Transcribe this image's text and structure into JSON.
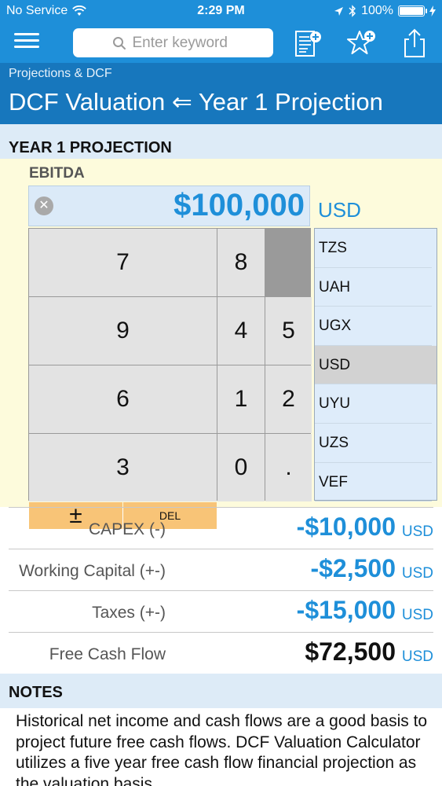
{
  "status_bar": {
    "carrier": "No Service",
    "time": "2:29 PM",
    "battery": "100%",
    "battery_level": 1.0
  },
  "nav": {
    "search_placeholder": "Enter keyword",
    "icons": [
      "menu-icon",
      "search-icon",
      "add-note-icon",
      "add-favorite-icon",
      "share-icon"
    ]
  },
  "header": {
    "breadcrumb": "Projections & DCF",
    "title": "DCF Valuation ⇐ Year 1 Projection"
  },
  "section": {
    "title": "YEAR 1 PROJECTION"
  },
  "input": {
    "label": "EBITDA",
    "value": "$100,000",
    "currency": "USD"
  },
  "keypad": {
    "keys": [
      "7",
      "8",
      "9",
      "4",
      "5",
      "6",
      "1",
      "2",
      "3",
      "0",
      ".",
      "±",
      "DEL"
    ]
  },
  "currencies": {
    "items": [
      "TZS",
      "UAH",
      "UGX",
      "USD",
      "UYU",
      "UZS",
      "VEF"
    ],
    "selected": "USD"
  },
  "results": [
    {
      "label": "CAPEX (-)",
      "value": "-$10,000",
      "unit": "USD"
    },
    {
      "label": "Working Capital (+-)",
      "value": "-$2,500",
      "unit": "USD"
    },
    {
      "label": "Taxes  (+-)",
      "value": "-$15,000",
      "unit": "USD"
    },
    {
      "label": "Free Cash Flow",
      "value": "$72,500",
      "unit": "USD"
    }
  ],
  "notes": {
    "title": "NOTES",
    "text": "Historical net income and cash flows are a good basis to project future free cash flows. DCF Valuation Calculator utilizes a five year free cash flow financial projection as the valuation basis."
  },
  "colors": {
    "nav_blue": "#1e8fd9",
    "title_blue": "#1777bd",
    "section_bg": "#ddebf7",
    "keypad_orange": "#f8c477",
    "input_bg": "#fdfbdc"
  }
}
